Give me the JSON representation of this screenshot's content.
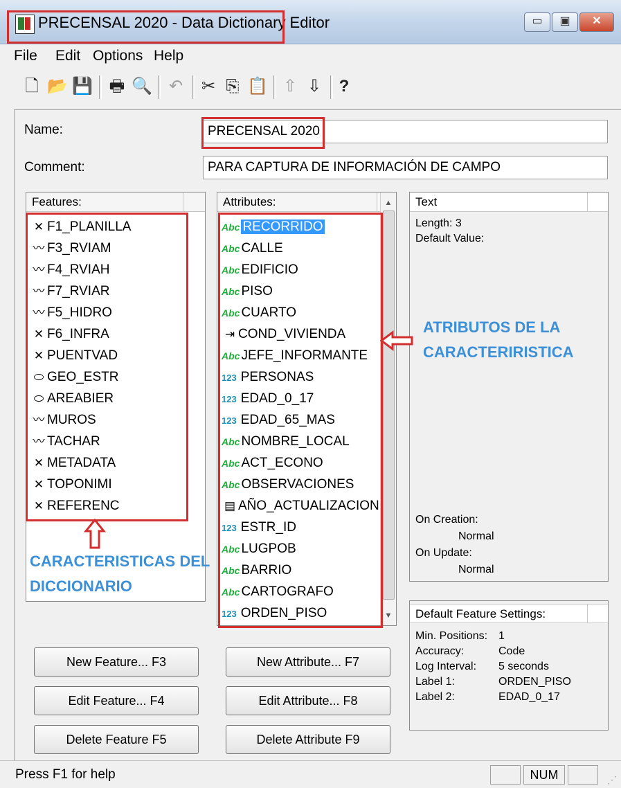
{
  "window": {
    "title": "PRECENSAL 2020 - Data Dictionary Editor",
    "controls": [
      "▭",
      "▣",
      "✕"
    ]
  },
  "menu": [
    "File",
    "Edit",
    "Options",
    "Help"
  ],
  "form": {
    "name_label": "Name:",
    "name_value": "PRECENSAL 2020",
    "comment_label": "Comment:",
    "comment_value": "PARA CAPTURA DE INFORMACIÓN DE CAMPO"
  },
  "features": {
    "header": "Features:",
    "items": [
      {
        "label": "F1_PLANILLA",
        "icon": "point"
      },
      {
        "label": "F3_RVIAM",
        "icon": "line"
      },
      {
        "label": "F4_RVIAH",
        "icon": "line"
      },
      {
        "label": "F7_RVIAR",
        "icon": "line"
      },
      {
        "label": "F5_HIDRO",
        "icon": "line"
      },
      {
        "label": "F6_INFRA",
        "icon": "point"
      },
      {
        "label": "PUENTVAD",
        "icon": "point"
      },
      {
        "label": "GEO_ESTR",
        "icon": "area"
      },
      {
        "label": "AREABIER",
        "icon": "area"
      },
      {
        "label": "MUROS",
        "icon": "line"
      },
      {
        "label": "TACHAR",
        "icon": "line"
      },
      {
        "label": "METADATA",
        "icon": "point"
      },
      {
        "label": "TOPONIMI",
        "icon": "point"
      },
      {
        "label": "REFERENC",
        "icon": "point"
      }
    ]
  },
  "attributes": {
    "header": "Attributes:",
    "items": [
      {
        "label": "RECORRIDO",
        "type": "text",
        "selected": true
      },
      {
        "label": "CALLE",
        "type": "text"
      },
      {
        "label": "EDIFICIO",
        "type": "text"
      },
      {
        "label": "PISO",
        "type": "text"
      },
      {
        "label": "CUARTO",
        "type": "text"
      },
      {
        "label": "COND_VIVIENDA",
        "type": "menu"
      },
      {
        "label": "JEFE_INFORMANTE",
        "type": "text"
      },
      {
        "label": "PERSONAS",
        "type": "numeric"
      },
      {
        "label": "EDAD_0_17",
        "type": "numeric"
      },
      {
        "label": "EDAD_65_MAS",
        "type": "numeric"
      },
      {
        "label": "NOMBRE_LOCAL",
        "type": "text"
      },
      {
        "label": "ACT_ECONO",
        "type": "text"
      },
      {
        "label": "OBSERVACIONES",
        "type": "text"
      },
      {
        "label": "AÑO_ACTUALIZACION",
        "type": "date"
      },
      {
        "label": "ESTR_ID",
        "type": "numeric"
      },
      {
        "label": "LUGPOB",
        "type": "text"
      },
      {
        "label": "BARRIO",
        "type": "text"
      },
      {
        "label": "CARTOGRAFO",
        "type": "text"
      },
      {
        "label": "ORDEN_PISO",
        "type": "numeric"
      }
    ],
    "icon_text": "Abc",
    "icon_num": "123"
  },
  "text_panel": {
    "header": "Text",
    "length": "Length: 3",
    "default_value": "Default Value:",
    "on_creation": "On Creation:",
    "on_creation_value": "Normal",
    "on_update": "On Update:",
    "on_update_value": "Normal"
  },
  "default_settings": {
    "header": "Default Feature Settings:",
    "rows": [
      {
        "k": "Min. Positions:",
        "v": "1"
      },
      {
        "k": "Accuracy:",
        "v": "Code"
      },
      {
        "k": "Log Interval:",
        "v": "5 seconds"
      },
      {
        "k": "Label 1:",
        "v": "ORDEN_PISO"
      },
      {
        "k": "Label 2:",
        "v": "EDAD_0_17"
      }
    ]
  },
  "buttons": {
    "new_feature": "New Feature... F3",
    "edit_feature": "Edit Feature... F4",
    "delete_feature": "Delete Feature F5",
    "new_attribute": "New Attribute... F7",
    "edit_attribute": "Edit Attribute... F8",
    "delete_attribute": "Delete Attribute F9"
  },
  "annotations": {
    "attributes_note": [
      "ATRIBUTOS DE LA",
      "CARACTERIRISTICA"
    ],
    "features_note": [
      "CARACTERISTICAS DEL",
      "DICCIONARIO"
    ]
  },
  "status": {
    "help": "Press F1 for help",
    "num": "NUM"
  },
  "colors": {
    "annotation": "#3d8fd6",
    "highlight_box": "#d32f2f",
    "selection": "#3399ff"
  }
}
